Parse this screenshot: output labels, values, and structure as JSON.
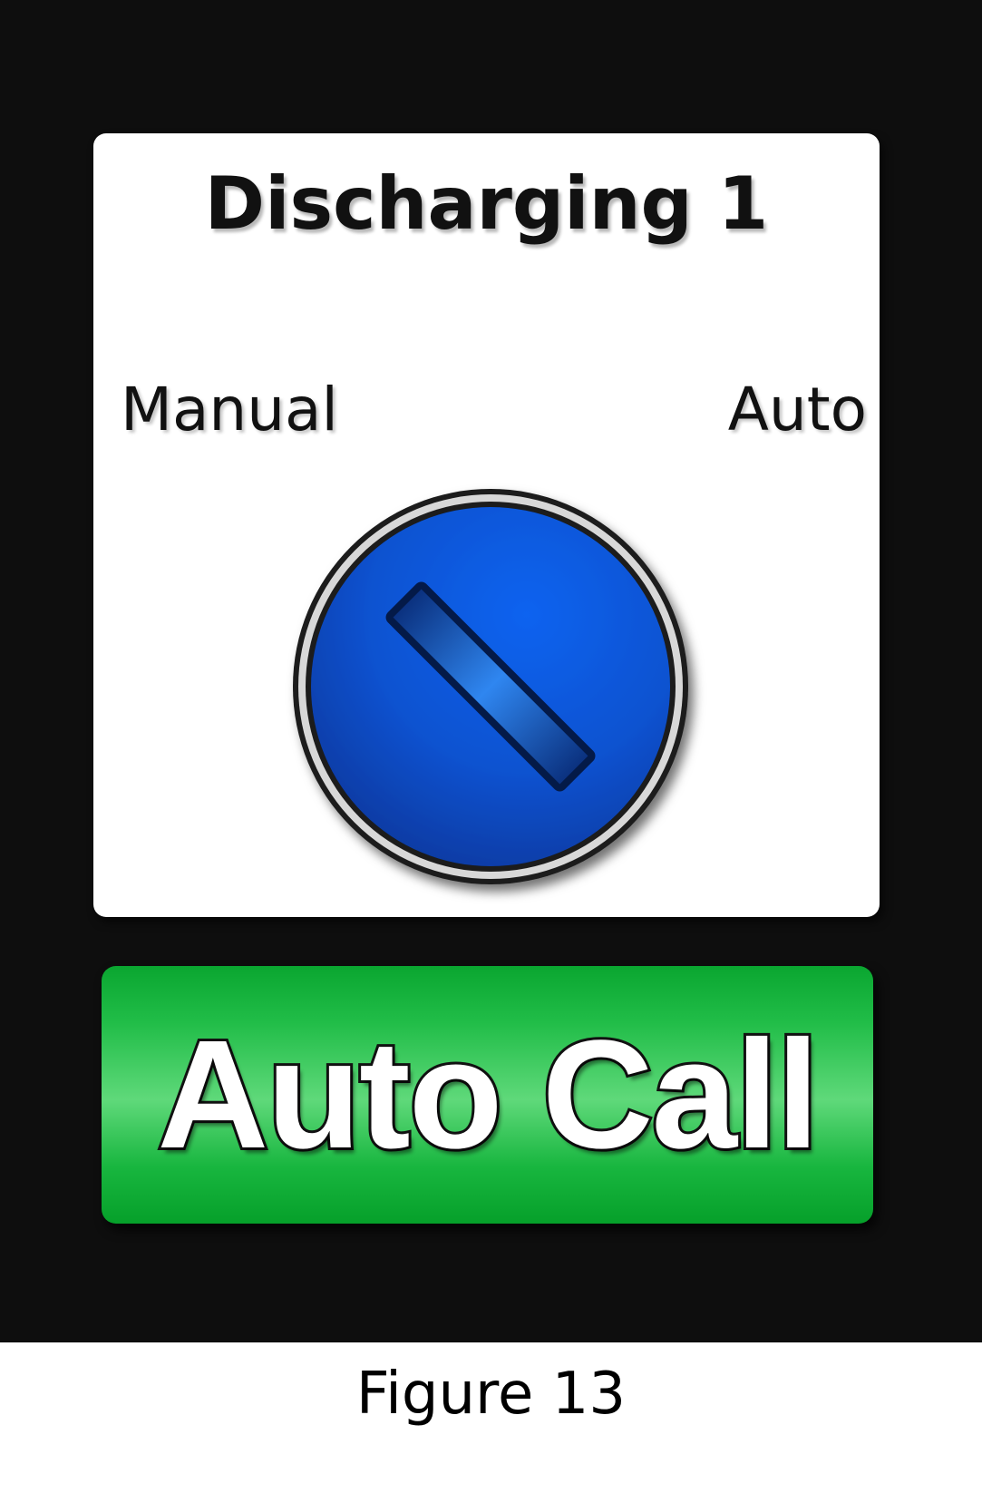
{
  "panel": {
    "title": "Discharging 1",
    "left_label": "Manual",
    "right_label": "Auto",
    "selector_icon": "rotary-selector-knob",
    "selector_color": "#0a5fe6"
  },
  "button": {
    "label": "Auto Call",
    "color": "#21bd48"
  },
  "caption": "Figure 13"
}
